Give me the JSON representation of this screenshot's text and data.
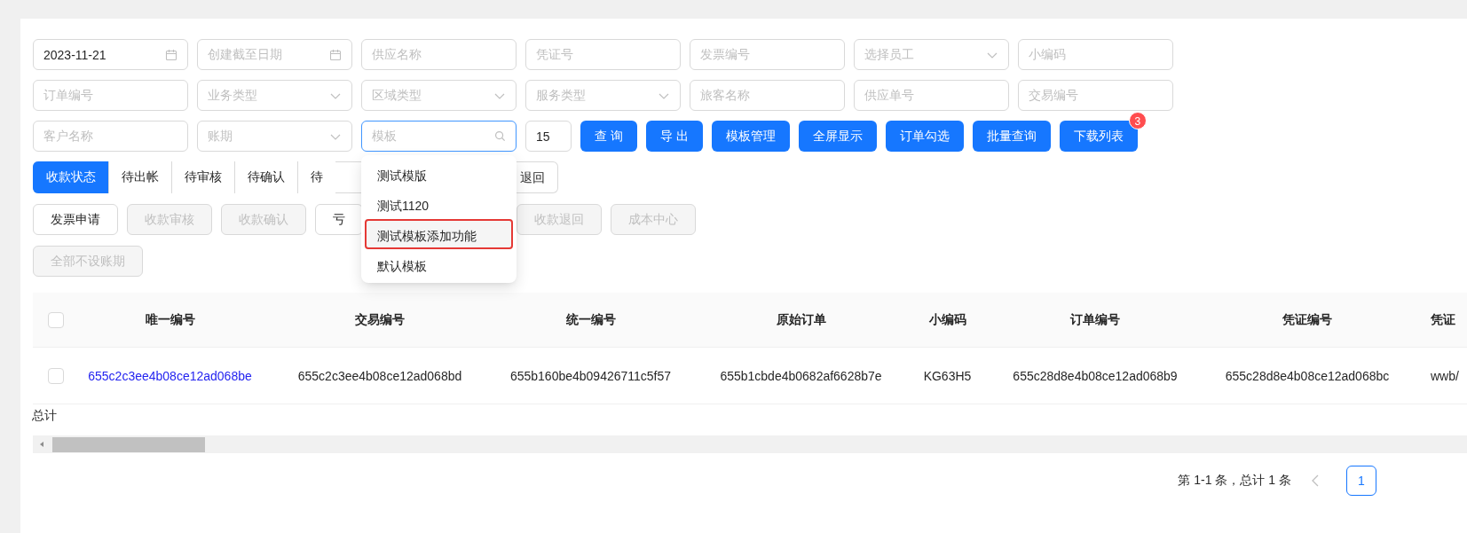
{
  "filters": {
    "rows": [
      [
        {
          "kind": "date",
          "value": "2023-11-21"
        },
        {
          "kind": "date",
          "placeholder": "创建截至日期"
        },
        {
          "kind": "text",
          "placeholder": "供应名称"
        },
        {
          "kind": "text",
          "placeholder": "凭证号"
        },
        {
          "kind": "text",
          "placeholder": "发票编号"
        },
        {
          "kind": "select",
          "placeholder": "选择员工"
        },
        {
          "kind": "text",
          "placeholder": "小编码"
        }
      ],
      [
        {
          "kind": "text",
          "placeholder": "订单编号"
        },
        {
          "kind": "select",
          "placeholder": "业务类型"
        },
        {
          "kind": "select",
          "placeholder": "区域类型"
        },
        {
          "kind": "select",
          "placeholder": "服务类型"
        },
        {
          "kind": "text",
          "placeholder": "旅客名称"
        },
        {
          "kind": "text",
          "placeholder": "供应单号"
        },
        {
          "kind": "text",
          "placeholder": "交易编号"
        }
      ],
      [
        {
          "kind": "text",
          "placeholder": "客户名称"
        },
        {
          "kind": "select",
          "placeholder": "账期"
        },
        {
          "kind": "search",
          "placeholder": "模板",
          "focused": true,
          "menu": true
        },
        {
          "kind": "number",
          "value": "15"
        }
      ]
    ],
    "buttons": [
      {
        "label": "查 询"
      },
      {
        "label": "导 出"
      },
      {
        "label": "模板管理"
      },
      {
        "label": "全屏显示"
      },
      {
        "label": "订单勾选"
      },
      {
        "label": "批量查询"
      },
      {
        "label": "下载列表",
        "badge": "3"
      }
    ]
  },
  "template_menu": [
    {
      "label": "测试模版",
      "selected": false
    },
    {
      "label": "测试1120",
      "selected": false
    },
    {
      "label": "测试模板添加功能",
      "selected": true
    },
    {
      "label": "默认模板",
      "selected": false
    }
  ],
  "status_tabs": {
    "before_menu": [
      {
        "label": "收款状态",
        "selected": true
      },
      {
        "label": "待出帐",
        "selected": false
      },
      {
        "label": "待审核",
        "selected": false
      },
      {
        "label": "待确认",
        "selected": false
      },
      {
        "label": "待",
        "selected": false
      }
    ],
    "after_menu": [
      {
        "label": "退回",
        "selected": false
      }
    ]
  },
  "actions": {
    "before_menu": [
      {
        "label": "发票申请",
        "disabled": false
      },
      {
        "label": "收款审核",
        "disabled": true
      },
      {
        "label": "收款确认",
        "disabled": true
      },
      {
        "label": "亏",
        "disabled": false
      }
    ],
    "after_menu": [
      {
        "label": "收款退回",
        "disabled": true
      },
      {
        "label": "成本中心",
        "disabled": true
      }
    ],
    "second_row": [
      {
        "label": "全部不设账期",
        "disabled": true
      }
    ]
  },
  "table": {
    "header_checked": false,
    "columns": [
      {
        "label": "唯一编号",
        "kind": "link"
      },
      {
        "label": "交易编号",
        "kind": "text"
      },
      {
        "label": "统一编号",
        "kind": "text"
      },
      {
        "label": "原始订单",
        "kind": "text"
      },
      {
        "label": "小编码",
        "kind": "text"
      },
      {
        "label": "订单编号",
        "kind": "text"
      },
      {
        "label": "凭证编号",
        "kind": "text"
      },
      {
        "label": "凭证",
        "kind": "text"
      }
    ],
    "rows": [
      {
        "checked": false,
        "cells": [
          "655c2c3ee4b08ce12ad068be",
          "655c2c3ee4b08ce12ad068bd",
          "655b160be4b09426711c5f57",
          "655b1cbde4b0682af6628b7e",
          "KG63H5",
          "655c28d8e4b08ce12ad068b9",
          "655c28d8e4b08ce12ad068bc",
          "wwb/"
        ]
      }
    ],
    "total_label": "总计"
  },
  "pagination": {
    "summary": "第 1-1 条，总计 1 条",
    "prev_disabled": true,
    "pages": [
      {
        "label": "1",
        "selected": true
      }
    ]
  }
}
